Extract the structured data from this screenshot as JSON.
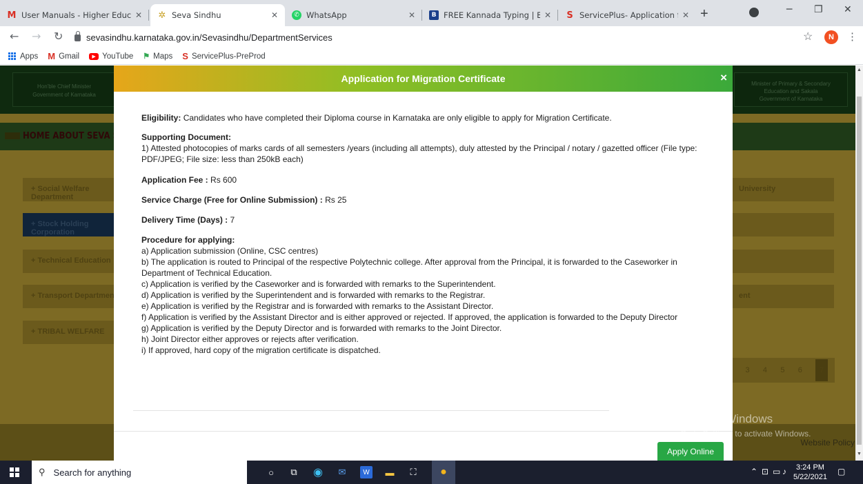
{
  "browser": {
    "tabs": [
      {
        "title": "User Manuals - Higher Educa",
        "icon": "gmail-icon"
      },
      {
        "title": "Seva Sindhu",
        "icon": "seva-sindhu-icon"
      },
      {
        "title": "WhatsApp",
        "icon": "whatsapp-icon"
      },
      {
        "title": "FREE Kannada Typing | Englis",
        "icon": "kannada-typing-icon"
      },
      {
        "title": "ServicePlus- Application for i",
        "icon": "serviceplus-icon"
      }
    ],
    "url": "sevasindhu.karnataka.gov.in/Sevasindhu/DepartmentServices",
    "profile_initial": "N",
    "bookmarks": [
      "Apps",
      "Gmail",
      "YouTube",
      "Maps",
      "ServicePlus-PreProd"
    ]
  },
  "page": {
    "header_left": "Hon'ble Chief Minister\nGovernment of Karnataka",
    "header_right": "Minister of Primary & Secondary\nEducation and Sakala\nGovernment of Karnataka",
    "nav_left": "HOME  ABOUT SEVA SINDHU",
    "departments": [
      "+ Social Welfare Department",
      "+ Stock Holding Corporation",
      "+ Technical Education",
      "+ Transport Department",
      "+ TRIBAL WELFARE"
    ],
    "right_rows": [
      "University",
      "",
      "",
      "ent"
    ],
    "pager": [
      "1",
      "2",
      "3",
      "4",
      "5",
      "6",
      "7"
    ],
    "website_policy": "Website Policy",
    "activate_title": "Activate Windows",
    "activate_sub": "Go to Settings to activate Windows."
  },
  "modal": {
    "title": "Application for Migration Certificate",
    "close": "×",
    "eligibility_label": "Eligibility:",
    "eligibility_text": "Candidates who have completed their Diploma course in Karnataka are only eligible to apply for Migration Certificate.",
    "supporting_label": "Supporting Document:",
    "supporting_text": "1) Attested photocopies of marks cards of all semesters /years (including all attempts), duly attested by the Principal / notary / gazetted officer (File type: PDF/JPEG; File size: less than 250kB each)",
    "fee_label": "Application Fee :",
    "fee_value": "Rs 600",
    "charge_label": "Service Charge (Free for Online Submission) :",
    "charge_value": "Rs 25",
    "delivery_label": "Delivery Time (Days) :",
    "delivery_value": "7",
    "procedure_label": "Procedure for applying:",
    "procedure_steps": [
      "a) Application submission (Online, CSC centres)",
      "b) The application is routed to Principal of the respective Polytechnic college. After approval from the Principal, it is forwarded to the Caseworker in Department of Technical Education.",
      "c) Application is verified by the Caseworker and is forwarded with remarks to the Superintendent.",
      "d) Application is verified by the Superintendent and is forwarded with remarks to the Registrar.",
      "e) Application is verified by the Registrar and is forwarded with remarks to the Assistant Director.",
      "f) Application is verified by the Assistant Director and is either approved or rejected. If approved, the application is forwarded to the Deputy Director",
      "g) Application is verified by the Deputy Director and is forwarded with remarks to the Joint Director.",
      "h) Joint Director either approves or rejects after verification.",
      "i) If approved, hard copy of the migration certificate is dispatched."
    ],
    "apply_button": "Apply Online"
  },
  "taskbar": {
    "search_placeholder": "Search for anything",
    "time": "3:24 PM",
    "date": "5/22/2021"
  },
  "colors": {
    "modal_header_start": "#e6a61a",
    "modal_header_end": "#3ba93a",
    "apply_button": "#28a745",
    "overlay": "#7d6a24"
  }
}
